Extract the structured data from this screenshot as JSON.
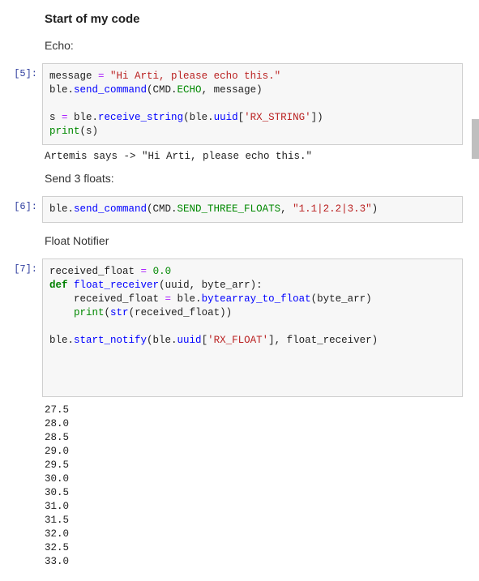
{
  "heading": "Start of my code",
  "sections": {
    "echo_label": "Echo:",
    "send3_label": "Send 3 floats:",
    "floatnot_label": "Float Notifier"
  },
  "prompts": {
    "c5": "[5]:",
    "c6": "[6]:",
    "c7": "[7]:"
  },
  "code5": {
    "l1a": "message ",
    "l1eq": "=",
    "l1b": " ",
    "l1str": "\"Hi Arti, please echo this.\"",
    "l2a": "ble.",
    "l2fn": "send_command",
    "l2b": "(CMD.",
    "l2cls": "ECHO",
    "l2c": ", message)",
    "blank": "",
    "l3a": "s ",
    "l3eq": "=",
    "l3b": " ble.",
    "l3fn": "receive_string",
    "l3c": "(ble.",
    "l3fn2": "uuid",
    "l3d": "[",
    "l3str": "'RX_STRING'",
    "l3e": "])",
    "l4a": "",
    "l4fn": "print",
    "l4b": "(s)"
  },
  "out5": "Artemis says -> \"Hi Arti, please echo this.\"",
  "code6": {
    "l1a": "ble.",
    "l1fn": "send_command",
    "l1b": "(CMD.",
    "l1cls": "SEND_THREE_FLOATS",
    "l1c": ", ",
    "l1str": "\"1.1|2.2|3.3\"",
    "l1d": ")"
  },
  "code7": {
    "l1a": "received_float ",
    "l1eq": "=",
    "l1b": " ",
    "l1num": "0.0",
    "l2kw": "def",
    "l2sp": " ",
    "l2fn": "float_receiver",
    "l2b": "(uuid, byte_arr):",
    "l3a": "    received_float ",
    "l3eq": "=",
    "l3b": " ble.",
    "l3fn": "bytearray_to_float",
    "l3c": "(byte_arr)",
    "l4a": "    ",
    "l4fn": "print",
    "l4b": "(",
    "l4fn2": "str",
    "l4c": "(received_float))",
    "blank": "",
    "l5a": "ble.",
    "l5fn": "start_notify",
    "l5b": "(ble.",
    "l5fn2": "uuid",
    "l5c": "[",
    "l5str": "'RX_FLOAT'",
    "l5d": "], float_receiver)"
  },
  "out7": "27.5\n28.0\n28.5\n29.0\n29.5\n30.0\n30.5\n31.0\n31.5\n32.0\n32.5\n33.0"
}
